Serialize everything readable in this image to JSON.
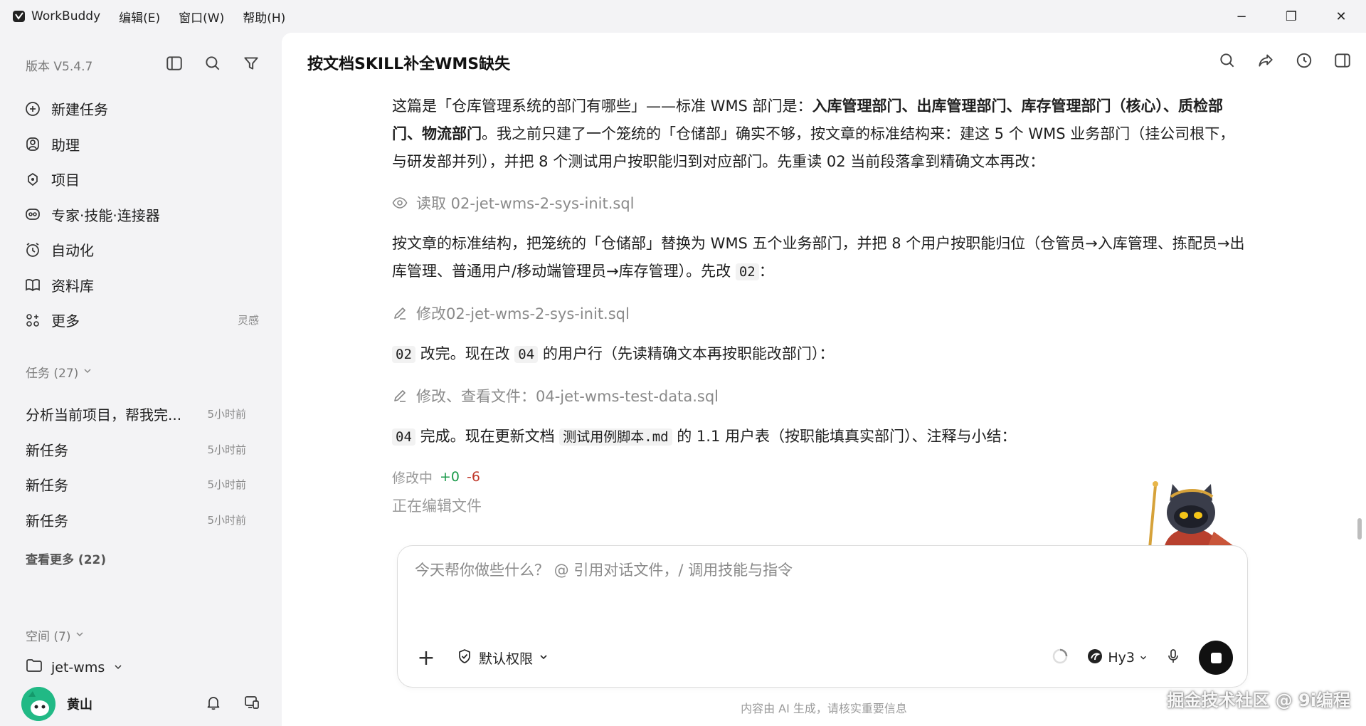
{
  "titlebar": {
    "app_name": "WorkBuddy",
    "menus": [
      "编辑(E)",
      "窗口(W)",
      "帮助(H)"
    ],
    "controls": {
      "minimize": "−",
      "maximize": "❐",
      "close": "✕"
    }
  },
  "sidebar": {
    "version": "版本 V5.4.7",
    "header_icons": [
      "sidebar-toggle-icon",
      "search-icon",
      "filter-icon"
    ],
    "nav": [
      {
        "label": "新建任务",
        "icon": "new-task-icon"
      },
      {
        "label": "助理",
        "icon": "assistant-icon"
      },
      {
        "label": "项目",
        "icon": "project-icon"
      },
      {
        "label": "专家·技能·连接器",
        "icon": "expert-icon"
      },
      {
        "label": "自动化",
        "icon": "automation-icon"
      },
      {
        "label": "资料库",
        "icon": "library-icon"
      },
      {
        "label": "更多",
        "icon": "more-icon",
        "tag": "灵感"
      }
    ],
    "tasks_header": "任务 (27)",
    "tasks": [
      {
        "title": "分析当前项目，帮我完...",
        "time": "5小时前"
      },
      {
        "title": "新任务",
        "time": "5小时前"
      },
      {
        "title": "新任务",
        "time": "5小时前"
      },
      {
        "title": "新任务",
        "time": "5小时前"
      }
    ],
    "more_link": "查看更多 (22)",
    "spaces_header": "空间 (7)",
    "space": "jet-wms",
    "user": "黄山"
  },
  "main": {
    "title": "按文档SKILL补全WMS缺失",
    "top_icons": [
      "search-icon",
      "share-icon",
      "history-icon",
      "panel-icon"
    ],
    "para1": {
      "a": "这篇是「仓库管理系统的部门有哪些」——标准 WMS 部门是：",
      "b": "入库管理部门、出库管理部门、库存管理部门（核心）、质检部门、物流部门",
      "c": "。我之前只建了一个笼统的「仓储部」确实不够，按文章的标准结构来：建这 5 个 WMS 业务部门（挂公司根下，与研发部并列），并把 8 个测试用户按职能归到对应部门。先重读 02 当前段落拿到精确文本再改："
    },
    "step1": "读取 02-jet-wms-2-sys-init.sql",
    "para2": {
      "a": "按文章的标准结构，把笼统的「仓储部」替换为 WMS 五个业务部门，并把 8 个用户按职能归位（仓管员→入库管理、拣配员→出库管理、普通用户/移动端管理员→库存管理）。先改 ",
      "code": "02",
      "b": "："
    },
    "step2": "修改02-jet-wms-2-sys-init.sql",
    "para3": {
      "code1": "02",
      "a": " 改完。现在改 ",
      "code2": "04",
      "b": " 的用户行（先读精确文本再按职能改部门）："
    },
    "step3": "修改、查看文件：04-jet-wms-test-data.sql",
    "para4": {
      "code1": "04",
      "a": " 完成。现在更新文档 ",
      "code2": "测试用例脚本.md",
      "b": " 的 1.1 用户表（按职能填真实部门）、注释与小结："
    },
    "status": {
      "label": "修改中",
      "add": "+0",
      "del": "-6"
    },
    "editing": "正在编辑文件",
    "input": {
      "placeholder": "今天帮你做些什么？ @ 引用对话文件，/ 调用技能与指令",
      "plus": "+",
      "permission": "默认权限",
      "model": "Hy3"
    },
    "footer": "内容由 AI 生成，请核实重要信息",
    "watermark": "掘金技术社区 @ 9i编程"
  }
}
